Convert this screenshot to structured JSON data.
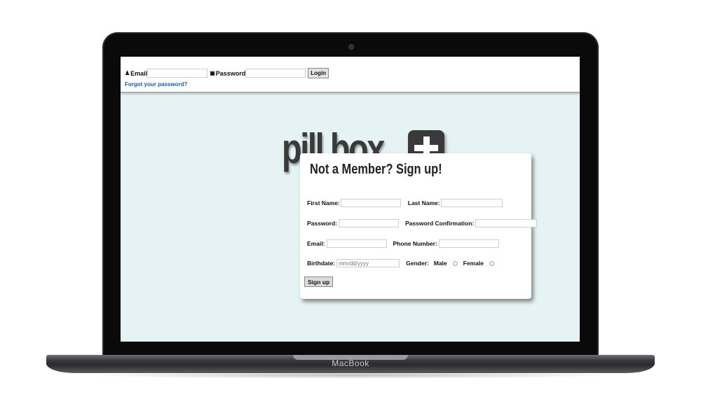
{
  "device": {
    "brand": "MacBook"
  },
  "login": {
    "email_label": "Email",
    "email_value": "",
    "password_label": "Password",
    "password_value": "",
    "login_label": "Login",
    "forgot_label": "Forgot your password?"
  },
  "logo": {
    "text": "pill.box"
  },
  "signup": {
    "title": "Not a Member? Sign up!",
    "first_name_label": "First Name:",
    "last_name_label": "Last Name:",
    "password_label": "Password:",
    "password_confirmation_label": "Password Confirmation:",
    "email_label": "Email:",
    "phone_label": "Phone Number:",
    "birthdate_label": "Birthdate:",
    "birthdate_placeholder": "mm/dd/yyyy",
    "gender_label": "Gender:",
    "gender_options": [
      "Male",
      "Female"
    ],
    "submit_label": "Sign up"
  },
  "colors": {
    "screen_background": "#e5f3f4",
    "link": "#1a5ea8",
    "logo": "#3a3a3a"
  }
}
